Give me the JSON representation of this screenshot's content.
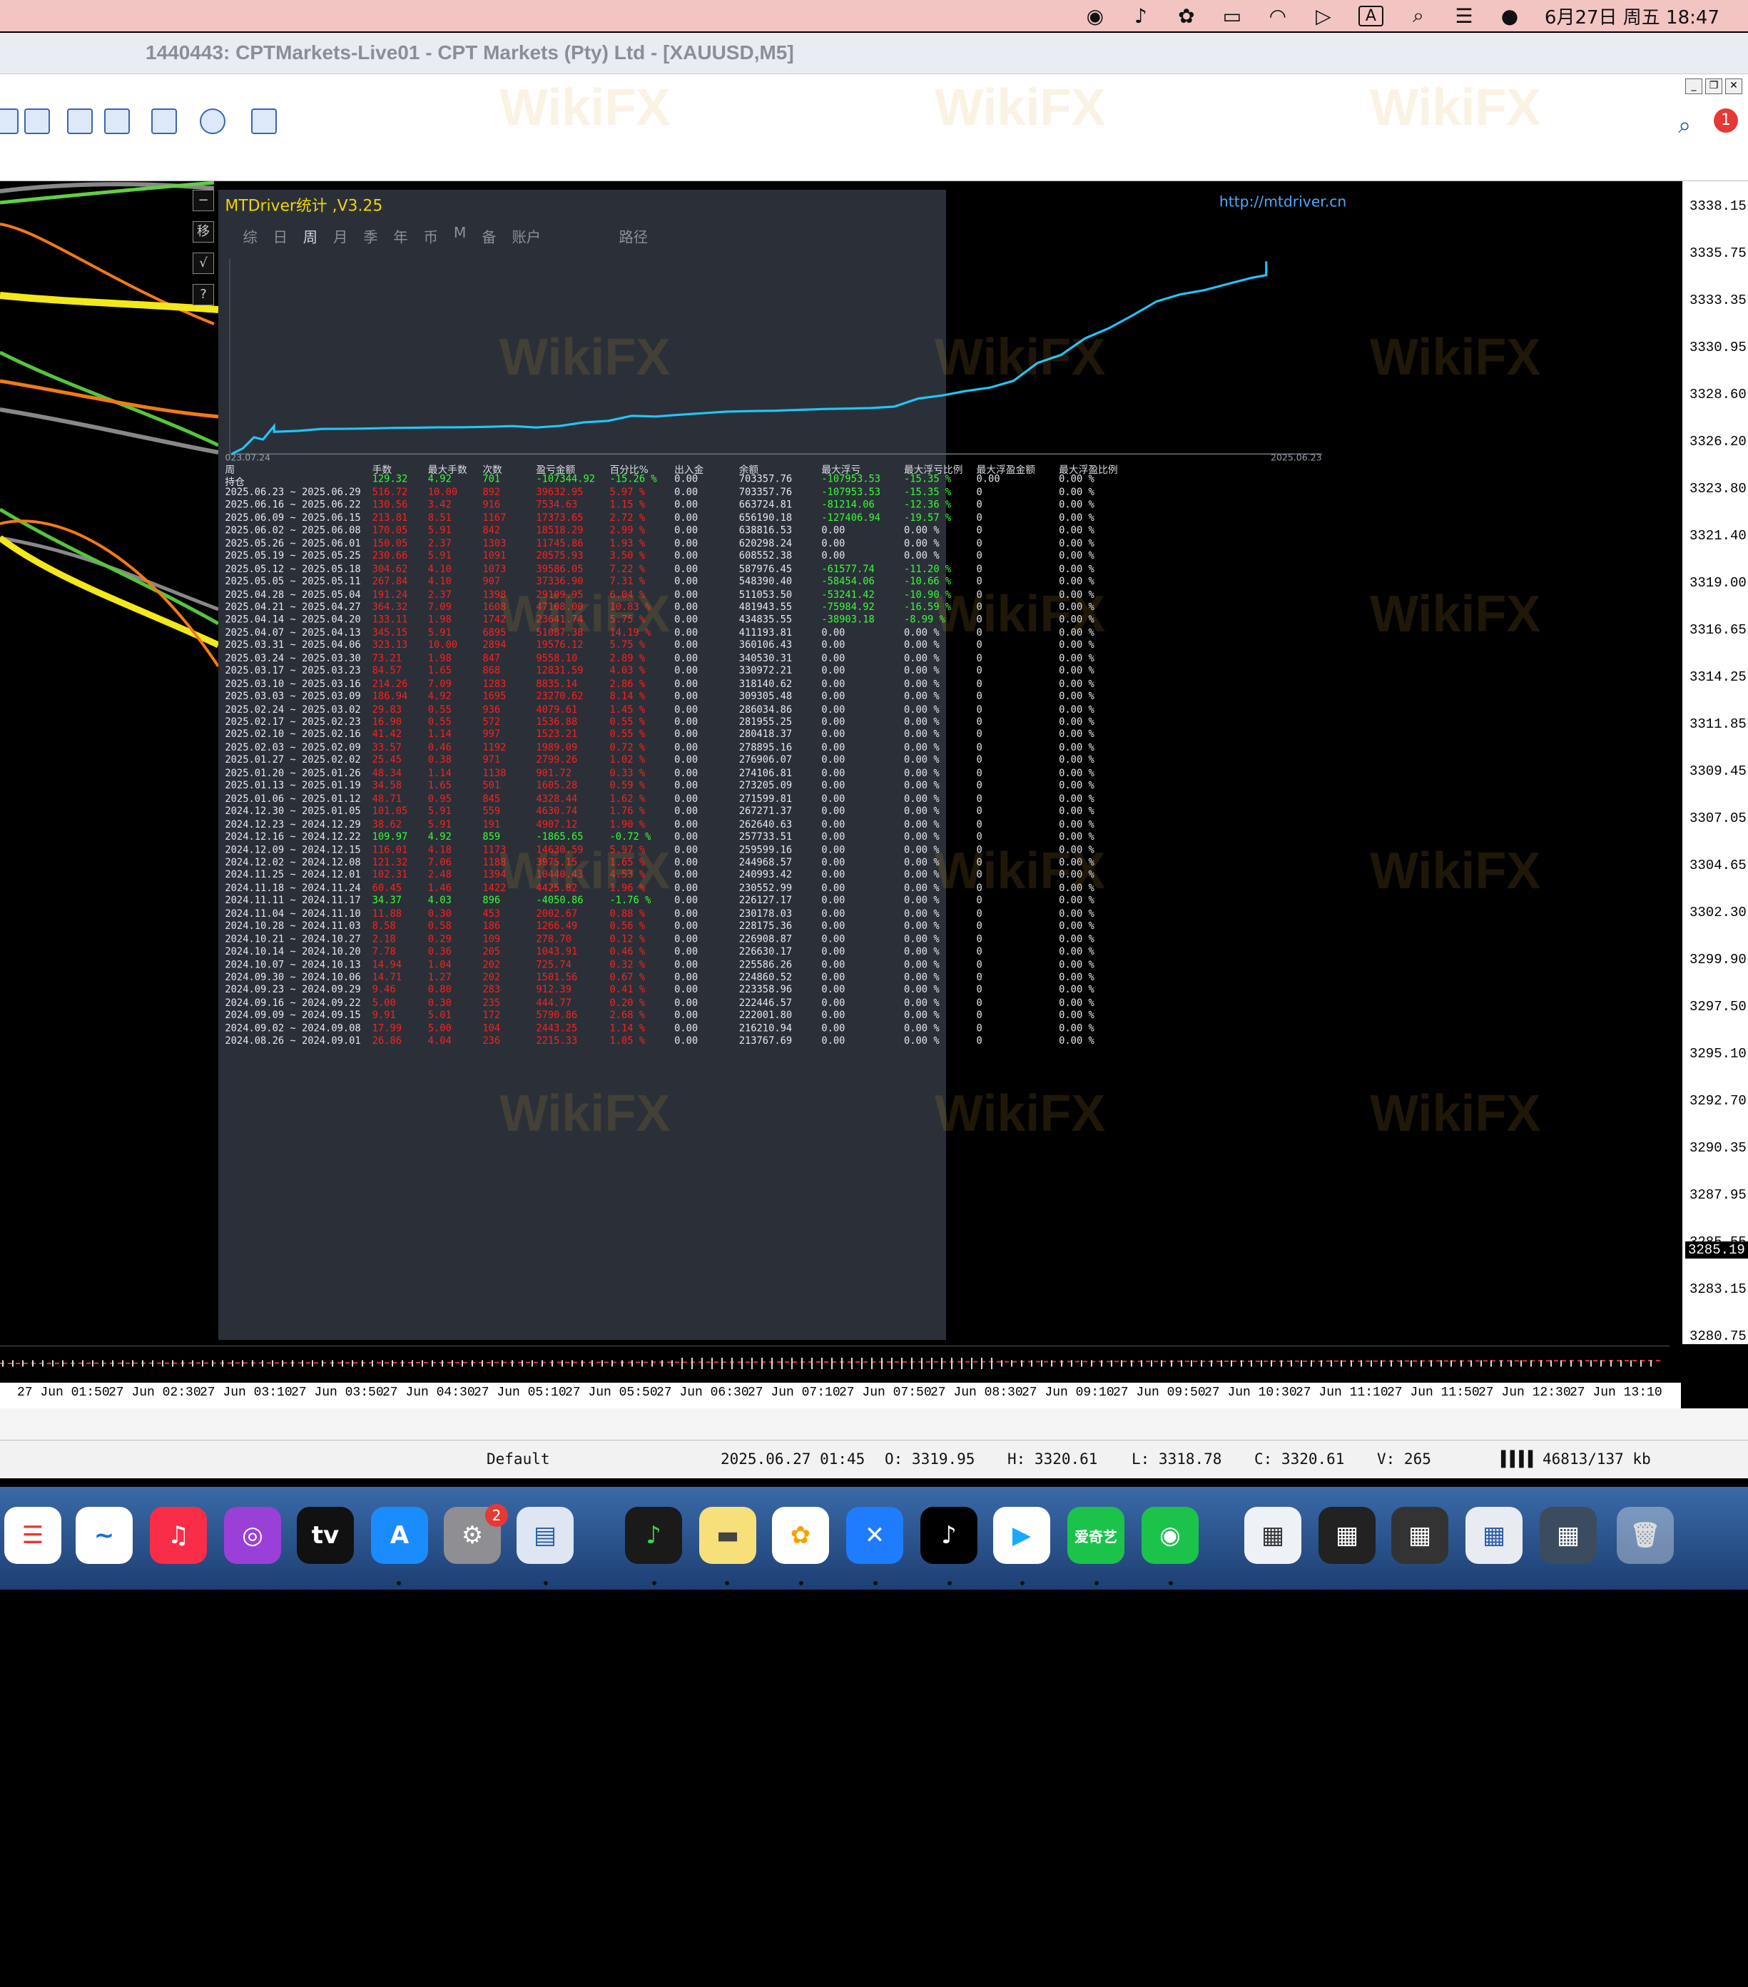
{
  "menubar": {
    "time": "6月27日 周五 18:47",
    "input_method": "A"
  },
  "window": {
    "title": "1440443: CPTMarkets-Live01 - CPT Markets (Pty) Ltd - [XAUUSD,M5]"
  },
  "notification_count": "1",
  "panel": {
    "title": "MTDriver统计 ,V3.25",
    "link": "http://mtdriver.cn",
    "tabs": [
      "综",
      "日",
      "周",
      "月",
      "季",
      "年",
      "币",
      "M",
      "备",
      "账户",
      "",
      "",
      "",
      "",
      "路径"
    ],
    "chart_start": "023.07.24",
    "chart_end": "2025.06.23",
    "headers": [
      "周",
      "手数",
      "最大手数",
      "次数",
      "盈亏金额",
      "百分比%",
      "出入金",
      "余额",
      "最大浮亏",
      "最大浮亏比例",
      "最大浮盈金额",
      "最大浮盈比例"
    ],
    "holding_row": [
      "持仓",
      "129.32",
      "4.92",
      "701",
      "-107344.92",
      "-15.26 %",
      "0.00",
      "703357.76",
      "-107953.53",
      "-15.35 %",
      "0.00",
      "0.00 %"
    ],
    "rows": [
      [
        "2025.06.23 ~ 2025.06.29",
        "516.72",
        "10.00",
        "892",
        "39632.95",
        "5.97 %",
        "0.00",
        "703357.76",
        "-107953.53",
        "-15.35 %",
        "0",
        "0.00 %"
      ],
      [
        "2025.06.16 ~ 2025.06.22",
        "130.56",
        "3.42",
        "916",
        "7534.63",
        "1.15 %",
        "0.00",
        "663724.81",
        "-81214.06",
        "-12.36 %",
        "0",
        "0.00 %"
      ],
      [
        "2025.06.09 ~ 2025.06.15",
        "213.81",
        "8.51",
        "1167",
        "17373.65",
        "2.72 %",
        "0.00",
        "656190.18",
        "-127406.94",
        "-19.57 %",
        "0",
        "0.00 %"
      ],
      [
        "2025.06.02 ~ 2025.06.08",
        "170.05",
        "5.91",
        "842",
        "18518.29",
        "2.99 %",
        "0.00",
        "638816.53",
        "0.00",
        "0.00 %",
        "0",
        "0.00 %"
      ],
      [
        "2025.05.26 ~ 2025.06.01",
        "150.05",
        "2.37",
        "1303",
        "11745.86",
        "1.93 %",
        "0.00",
        "620298.24",
        "0.00",
        "0.00 %",
        "0",
        "0.00 %"
      ],
      [
        "2025.05.19 ~ 2025.05.25",
        "230.66",
        "5.91",
        "1091",
        "20575.93",
        "3.50 %",
        "0.00",
        "608552.38",
        "0.00",
        "0.00 %",
        "0",
        "0.00 %"
      ],
      [
        "2025.05.12 ~ 2025.05.18",
        "304.62",
        "4.10",
        "1073",
        "39586.05",
        "7.22 %",
        "0.00",
        "587976.45",
        "-61577.74",
        "-11.20 %",
        "0",
        "0.00 %"
      ],
      [
        "2025.05.05 ~ 2025.05.11",
        "267.84",
        "4.10",
        "907",
        "37336.90",
        "7.31 %",
        "0.00",
        "548390.40",
        "-58454.06",
        "-10.66 %",
        "0",
        "0.00 %"
      ],
      [
        "2025.04.28 ~ 2025.05.04",
        "191.24",
        "2.37",
        "1398",
        "29109.95",
        "6.04 %",
        "0.00",
        "511053.50",
        "-53241.42",
        "-10.90 %",
        "0",
        "0.00 %"
      ],
      [
        "2025.04.21 ~ 2025.04.27",
        "364.32",
        "7.09",
        "1608",
        "47108.00",
        "10.83 %",
        "0.00",
        "481943.55",
        "-75984.92",
        "-16.59 %",
        "0",
        "0.00 %"
      ],
      [
        "2025.04.14 ~ 2025.04.20",
        "133.11",
        "1.98",
        "1742",
        "23641.74",
        "5.75 %",
        "0.00",
        "434835.55",
        "-38903.18",
        "-8.99 %",
        "0",
        "0.00 %"
      ],
      [
        "2025.04.07 ~ 2025.04.13",
        "345.15",
        "5.91",
        "6895",
        "51087.38",
        "14.19 %",
        "0.00",
        "411193.81",
        "0.00",
        "0.00 %",
        "0",
        "0.00 %"
      ],
      [
        "2025.03.31 ~ 2025.04.06",
        "323.13",
        "10.00",
        "2894",
        "19576.12",
        "5.75 %",
        "0.00",
        "360106.43",
        "0.00",
        "0.00 %",
        "0",
        "0.00 %"
      ],
      [
        "2025.03.24 ~ 2025.03.30",
        "73.21",
        "1.98",
        "847",
        "9558.10",
        "2.89 %",
        "0.00",
        "340530.31",
        "0.00",
        "0.00 %",
        "0",
        "0.00 %"
      ],
      [
        "2025.03.17 ~ 2025.03.23",
        "84.57",
        "1.65",
        "868",
        "12831.59",
        "4.03 %",
        "0.00",
        "330972.21",
        "0.00",
        "0.00 %",
        "0",
        "0.00 %"
      ],
      [
        "2025.03.10 ~ 2025.03.16",
        "214.26",
        "7.09",
        "1283",
        "8835.14",
        "2.86 %",
        "0.00",
        "318140.62",
        "0.00",
        "0.00 %",
        "0",
        "0.00 %"
      ],
      [
        "2025.03.03 ~ 2025.03.09",
        "186.94",
        "4.92",
        "1695",
        "23270.62",
        "8.14 %",
        "0.00",
        "309305.48",
        "0.00",
        "0.00 %",
        "0",
        "0.00 %"
      ],
      [
        "2025.02.24 ~ 2025.03.02",
        "29.83",
        "0.55",
        "936",
        "4079.61",
        "1.45 %",
        "0.00",
        "286034.86",
        "0.00",
        "0.00 %",
        "0",
        "0.00 %"
      ],
      [
        "2025.02.17 ~ 2025.02.23",
        "16.90",
        "0.55",
        "572",
        "1536.88",
        "0.55 %",
        "0.00",
        "281955.25",
        "0.00",
        "0.00 %",
        "0",
        "0.00 %"
      ],
      [
        "2025.02.10 ~ 2025.02.16",
        "41.42",
        "1.14",
        "997",
        "1523.21",
        "0.55 %",
        "0.00",
        "280418.37",
        "0.00",
        "0.00 %",
        "0",
        "0.00 %"
      ],
      [
        "2025.02.03 ~ 2025.02.09",
        "33.57",
        "0.46",
        "1192",
        "1989.09",
        "0.72 %",
        "0.00",
        "278895.16",
        "0.00",
        "0.00 %",
        "0",
        "0.00 %"
      ],
      [
        "2025.01.27 ~ 2025.02.02",
        "25.45",
        "0.38",
        "971",
        "2799.26",
        "1.02 %",
        "0.00",
        "276906.07",
        "0.00",
        "0.00 %",
        "0",
        "0.00 %"
      ],
      [
        "2025.01.20 ~ 2025.01.26",
        "48.34",
        "1.14",
        "1138",
        "901.72",
        "0.33 %",
        "0.00",
        "274106.81",
        "0.00",
        "0.00 %",
        "0",
        "0.00 %"
      ],
      [
        "2025.01.13 ~ 2025.01.19",
        "34.58",
        "1.65",
        "501",
        "1605.28",
        "0.59 %",
        "0.00",
        "273205.09",
        "0.00",
        "0.00 %",
        "0",
        "0.00 %"
      ],
      [
        "2025.01.06 ~ 2025.01.12",
        "48.71",
        "0.95",
        "845",
        "4328.44",
        "1.62 %",
        "0.00",
        "271599.81",
        "0.00",
        "0.00 %",
        "0",
        "0.00 %"
      ],
      [
        "2024.12.30 ~ 2025.01.05",
        "101.05",
        "5.91",
        "559",
        "4630.74",
        "1.76 %",
        "0.00",
        "267271.37",
        "0.00",
        "0.00 %",
        "0",
        "0.00 %"
      ],
      [
        "2024.12.23 ~ 2024.12.29",
        "38.62",
        "5.91",
        "191",
        "4907.12",
        "1.90 %",
        "0.00",
        "262640.63",
        "0.00",
        "0.00 %",
        "0",
        "0.00 %"
      ],
      [
        "2024.12.16 ~ 2024.12.22",
        "109.97",
        "4.92",
        "859",
        "-1865.65",
        "-0.72 %",
        "0.00",
        "257733.51",
        "0.00",
        "0.00 %",
        "0",
        "0.00 %"
      ],
      [
        "2024.12.09 ~ 2024.12.15",
        "116.01",
        "4.18",
        "1173",
        "14630.59",
        "5.97 %",
        "0.00",
        "259599.16",
        "0.00",
        "0.00 %",
        "0",
        "0.00 %"
      ],
      [
        "2024.12.02 ~ 2024.12.08",
        "121.32",
        "7.06",
        "1188",
        "3975.15",
        "1.65 %",
        "0.00",
        "244968.57",
        "0.00",
        "0.00 %",
        "0",
        "0.00 %"
      ],
      [
        "2024.11.25 ~ 2024.12.01",
        "102.31",
        "2.48",
        "1394",
        "10440.43",
        "4.53 %",
        "0.00",
        "240993.42",
        "0.00",
        "0.00 %",
        "0",
        "0.00 %"
      ],
      [
        "2024.11.18 ~ 2024.11.24",
        "60.45",
        "1.46",
        "1422",
        "4425.82",
        "1.96 %",
        "0.00",
        "230552.99",
        "0.00",
        "0.00 %",
        "0",
        "0.00 %"
      ],
      [
        "2024.11.11 ~ 2024.11.17",
        "34.37",
        "4.03",
        "896",
        "-4050.86",
        "-1.76 %",
        "0.00",
        "226127.17",
        "0.00",
        "0.00 %",
        "0",
        "0.00 %"
      ],
      [
        "2024.11.04 ~ 2024.11.10",
        "11.88",
        "0.30",
        "453",
        "2002.67",
        "0.88 %",
        "0.00",
        "230178.03",
        "0.00",
        "0.00 %",
        "0",
        "0.00 %"
      ],
      [
        "2024.10.28 ~ 2024.11.03",
        "8.58",
        "0.58",
        "186",
        "1266.49",
        "0.56 %",
        "0.00",
        "228175.36",
        "0.00",
        "0.00 %",
        "0",
        "0.00 %"
      ],
      [
        "2024.10.21 ~ 2024.10.27",
        "2.18",
        "0.29",
        "109",
        "278.70",
        "0.12 %",
        "0.00",
        "226908.87",
        "0.00",
        "0.00 %",
        "0",
        "0.00 %"
      ],
      [
        "2024.10.14 ~ 2024.10.20",
        "7.78",
        "0.36",
        "205",
        "1043.91",
        "0.46 %",
        "0.00",
        "226630.17",
        "0.00",
        "0.00 %",
        "0",
        "0.00 %"
      ],
      [
        "2024.10.07 ~ 2024.10.13",
        "14.94",
        "1.04",
        "202",
        "725.74",
        "0.32 %",
        "0.00",
        "225586.26",
        "0.00",
        "0.00 %",
        "0",
        "0.00 %"
      ],
      [
        "2024.09.30 ~ 2024.10.06",
        "14.71",
        "1.27",
        "202",
        "1501.56",
        "0.67 %",
        "0.00",
        "224860.52",
        "0.00",
        "0.00 %",
        "0",
        "0.00 %"
      ],
      [
        "2024.09.23 ~ 2024.09.29",
        "9.46",
        "0.80",
        "283",
        "912.39",
        "0.41 %",
        "0.00",
        "223358.96",
        "0.00",
        "0.00 %",
        "0",
        "0.00 %"
      ],
      [
        "2024.09.16 ~ 2024.09.22",
        "5.00",
        "0.30",
        "235",
        "444.77",
        "0.20 %",
        "0.00",
        "222446.57",
        "0.00",
        "0.00 %",
        "0",
        "0.00 %"
      ],
      [
        "2024.09.09 ~ 2024.09.15",
        "9.91",
        "5.01",
        "172",
        "5790.86",
        "2.68 %",
        "0.00",
        "222001.80",
        "0.00",
        "0.00 %",
        "0",
        "0.00 %"
      ],
      [
        "2024.09.02 ~ 2024.09.08",
        "17.99",
        "5.00",
        "104",
        "2443.25",
        "1.14 %",
        "0.00",
        "216210.94",
        "0.00",
        "0.00 %",
        "0",
        "0.00 %"
      ],
      [
        "2024.08.26 ~ 2024.09.01",
        "26.86",
        "4.04",
        "236",
        "2215.33",
        "1.05 %",
        "0.00",
        "213767.69",
        "0.00",
        "0.00 %",
        "0",
        "0.00 %"
      ]
    ]
  },
  "price_axis": [
    "3338.15",
    "3335.75",
    "3333.35",
    "3330.95",
    "3328.60",
    "3326.20",
    "3323.80",
    "3321.40",
    "3319.00",
    "3316.65",
    "3314.25",
    "3311.85",
    "3309.45",
    "3307.05",
    "3304.65",
    "3302.30",
    "3299.90",
    "3297.50",
    "3295.10",
    "3292.70",
    "3290.35",
    "3287.95",
    "3285.55",
    "3283.15",
    "3280.75"
  ],
  "current_price": "3285.19",
  "time_axis": [
    "27 Jun 01:50",
    "27 Jun 02:30",
    "27 Jun 03:10",
    "27 Jun 03:50",
    "27 Jun 04:30",
    "27 Jun 05:10",
    "27 Jun 05:50",
    "27 Jun 06:30",
    "27 Jun 07:10",
    "27 Jun 07:50",
    "27 Jun 08:30",
    "27 Jun 09:10",
    "27 Jun 09:50",
    "27 Jun 10:30",
    "27 Jun 11:10",
    "27 Jun 11:50",
    "27 Jun 12:30",
    "27 Jun 13:10"
  ],
  "status": {
    "profile": "Default",
    "datetime": "2025.06.27 01:45",
    "open": "O: 3319.95",
    "high": "H: 3320.61",
    "low": "L: 3318.78",
    "close": "C: 3320.61",
    "volume": "V: 265",
    "traffic": "46813/137 kb"
  },
  "dock": {
    "settings_badge": "2",
    "iqiyi_label": "爱奇艺"
  },
  "watermark": "WikiFX",
  "colors": {
    "profit": "#ff1e1e",
    "loss": "#33ff33",
    "equity_line": "#1ec8ff",
    "panel_bg": "#2b3038",
    "title": "#f2d600"
  }
}
